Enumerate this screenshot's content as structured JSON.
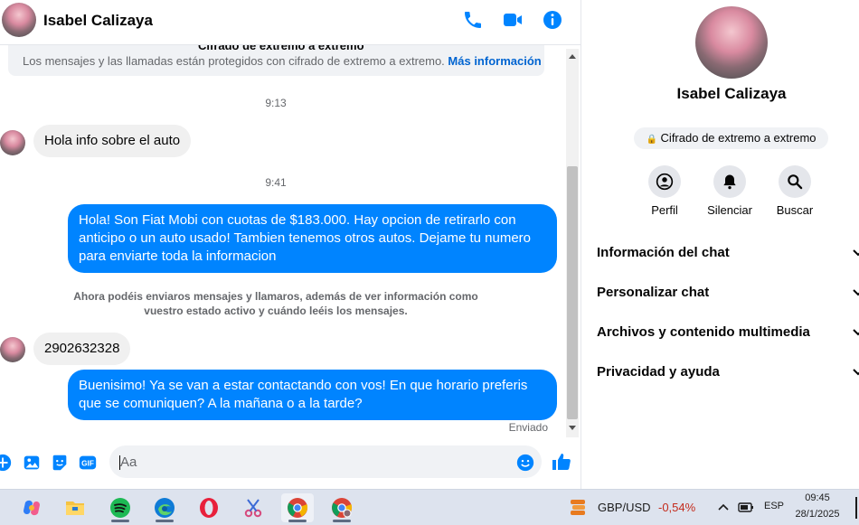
{
  "contact": {
    "name": "Isabel Calizaya"
  },
  "encryption": {
    "cut_title": "Cifrado de extremo a extremo",
    "notice": "Los mensajes y las llamadas están protegidos con cifrado de extremo a extremo.",
    "link": "Más información"
  },
  "messages": {
    "ts1": "9:13",
    "in1": "Hola info sobre el auto",
    "ts2": "9:41",
    "out1": "Hola! Son Fiat Mobi con cuotas de $183.000. Hay opcion de retirarlo con anticipo o un auto usado! Tambien tenemos otros autos. Dejame tu numero para enviarte toda la informacion",
    "system": "Ahora podéis enviaros mensajes y llamaros, además de ver información como vuestro estado activo y cuándo leéis los mensajes.",
    "in2": "2902632328",
    "out2": "Buenisimo! Ya se van a estar contactando con vos! En que horario preferis que se comuniquen? A la mañana o a la tarde?",
    "status": "Enviado"
  },
  "composer": {
    "placeholder": "Aa"
  },
  "info_panel": {
    "name": "Isabel Calizaya",
    "badge": "Cifrado de extremo a extremo",
    "actions": [
      {
        "label": "Perfil"
      },
      {
        "label": "Silenciar"
      },
      {
        "label": "Buscar"
      }
    ],
    "sections": [
      {
        "label": "Información del chat"
      },
      {
        "label": "Personalizar chat"
      },
      {
        "label": "Archivos y contenido multimedia"
      },
      {
        "label": "Privacidad y ayuda"
      }
    ]
  },
  "taskbar": {
    "ticker_name": "GBP/USD",
    "ticker_value": "-0,54%",
    "lang": "ESP",
    "time": "09:45",
    "date": "28/1/2025"
  },
  "colors": {
    "accent": "#0084ff",
    "link": "#0064d1",
    "negative": "#c42b1c"
  }
}
